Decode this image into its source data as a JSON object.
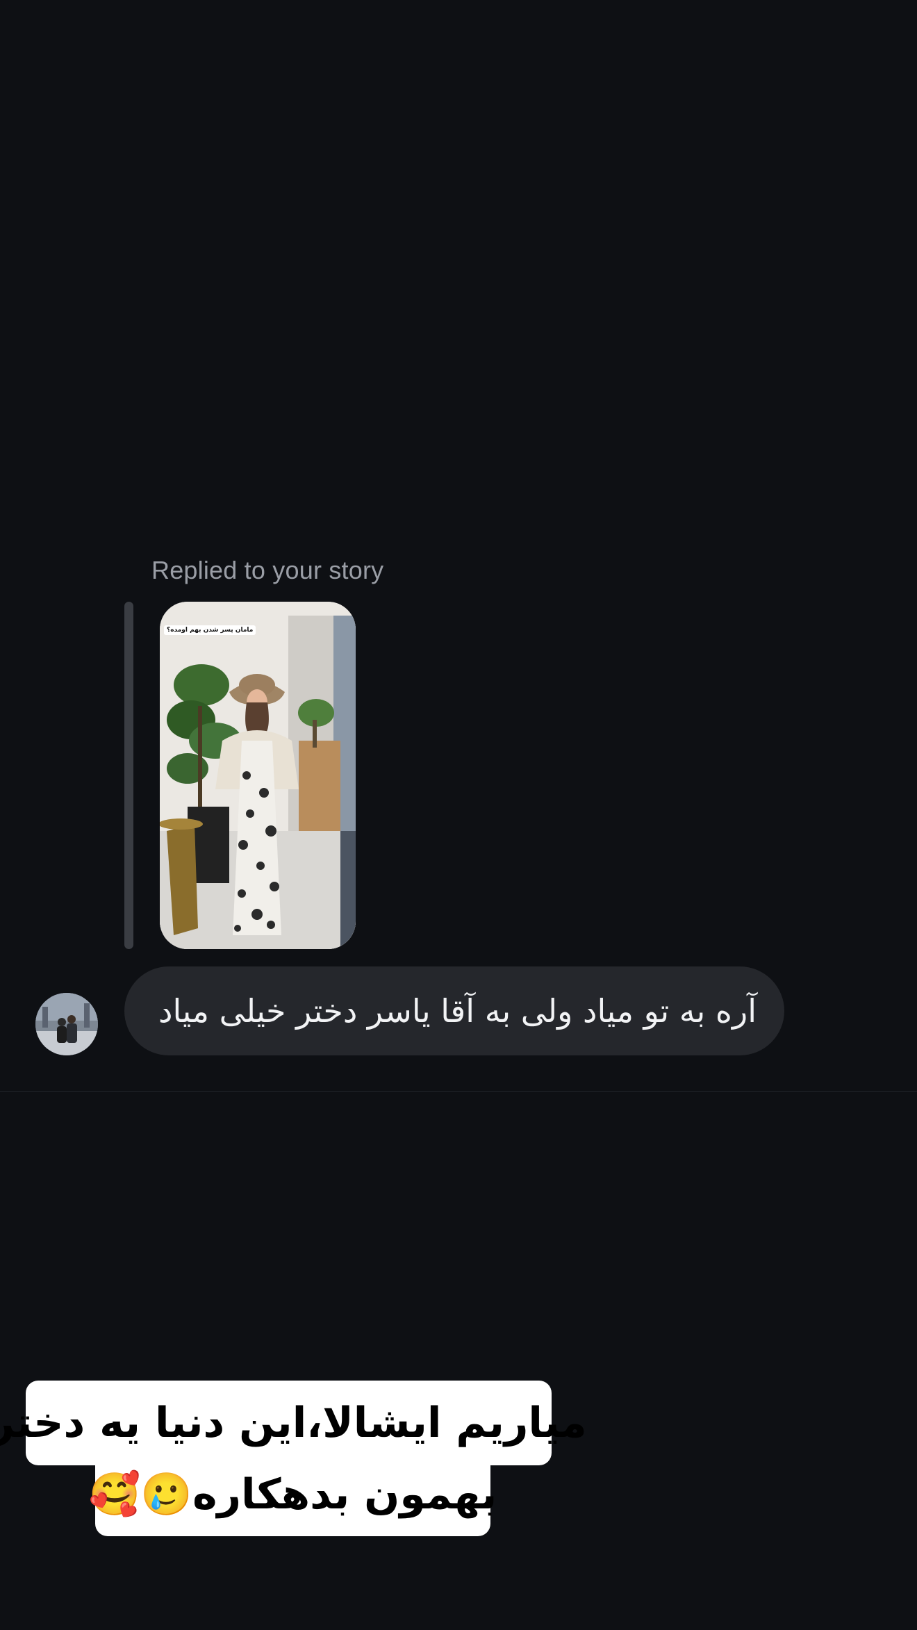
{
  "story_reply": {
    "header": "Replied to your story",
    "thumbnail_caption": "مامان پسر شدن بهم اومده؟"
  },
  "message": {
    "text": "آره به تو میاد ولی به آقا یاسر دختر خیلی میاد"
  },
  "overlay_caption": {
    "line1": "میاریم ایشالا،این دنیا یه دختر",
    "line2": "بهمون بدهکاره🥲🥰"
  },
  "colors": {
    "background": "#0e1014",
    "bubble": "#25272c",
    "muted_text": "#9a9ea6",
    "caption_bg": "#ffffff"
  }
}
